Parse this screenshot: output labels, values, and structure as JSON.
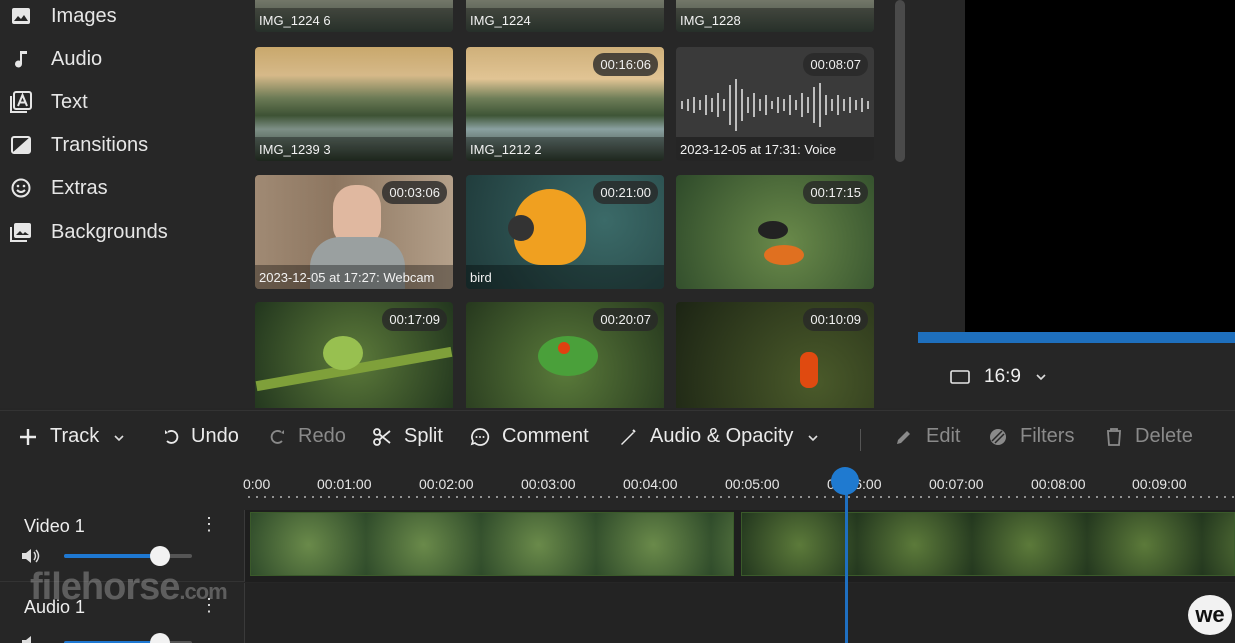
{
  "sidebar": {
    "items": [
      {
        "label": "Images",
        "icon": "image-icon"
      },
      {
        "label": "Audio",
        "icon": "music-note-icon"
      },
      {
        "label": "Text",
        "icon": "text-icon"
      },
      {
        "label": "Transitions",
        "icon": "transitions-icon"
      },
      {
        "label": "Extras",
        "icon": "smiley-icon"
      },
      {
        "label": "Backgrounds",
        "icon": "backgrounds-icon"
      }
    ]
  },
  "media": {
    "items": [
      {
        "name": "IMG_1224 6",
        "duration": ""
      },
      {
        "name": "IMG_1224",
        "duration": ""
      },
      {
        "name": "IMG_1228",
        "duration": ""
      },
      {
        "name": "IMG_1239 3",
        "duration": ""
      },
      {
        "name": "IMG_1212 2",
        "duration": "00:16:06"
      },
      {
        "name": "2023-12-05 at 17:31: Voice",
        "duration": "00:08:07"
      },
      {
        "name": "2023-12-05 at 17:27: Webcam",
        "duration": "00:03:06"
      },
      {
        "name": "bird",
        "duration": "00:21:00"
      },
      {
        "name": "",
        "duration": "00:17:15"
      },
      {
        "name": "",
        "duration": "00:17:09"
      },
      {
        "name": "",
        "duration": "00:20:07"
      },
      {
        "name": "",
        "duration": "00:10:09"
      }
    ]
  },
  "preview": {
    "aspect_ratio": "16:9"
  },
  "toolbar": {
    "track": "Track",
    "undo": "Undo",
    "redo": "Redo",
    "split": "Split",
    "comment": "Comment",
    "audio_opacity": "Audio & Opacity",
    "edit": "Edit",
    "filters": "Filters",
    "delete": "Delete"
  },
  "ruler": {
    "ticks": [
      "0:00",
      "00:01:00",
      "00:02:00",
      "00:03:00",
      "00:04:00",
      "00:05:00",
      "00:06:00",
      "00:07:00",
      "00:08:00",
      "00:09:00"
    ]
  },
  "tracks": [
    {
      "name": "Video 1",
      "volume": 0.75
    },
    {
      "name": "Audio 1",
      "volume": 0.75
    }
  ],
  "watermark": {
    "text": "filehorse",
    "suffix": ".com"
  },
  "brand": {
    "badge": "we"
  },
  "colors": {
    "accent": "#1f7ad0"
  }
}
